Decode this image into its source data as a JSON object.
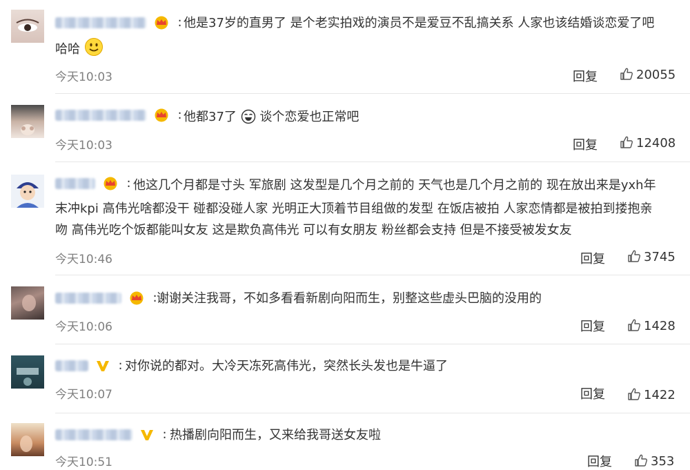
{
  "comments": [
    {
      "text_lines": [
        "他是37岁的直男了 是个老实拍戏的演员不是爱豆不乱搞关系 人家也该结婚谈恋爱了吧",
        "哈哈"
      ],
      "time": "今天10:03",
      "reply": "回复",
      "likes": "20055",
      "badge": "crown-badge-icon"
    },
    {
      "text_lines": [
        "他都37了",
        "谈个恋爱也正常吧"
      ],
      "time": "今天10:03",
      "reply": "回复",
      "likes": "12408",
      "badge": "crown-badge-icon"
    },
    {
      "text_lines": [
        "他这几个月都是寸头 军旅剧 这发型是几个月之前的 天气也是几个月之前的 现在放出来是yxh年",
        "末冲kpi 高伟光啥都没干 碰都没碰人家 光明正大顶着节目组做的发型 在饭店被拍 人家恋情都是被拍到搂抱亲",
        "吻 高伟光吃个饭都能叫女友 这是欺负高伟光 可以有女朋友 粉丝都会支持 但是不接受被发女友"
      ],
      "time": "今天10:46",
      "reply": "回复",
      "likes": "3745",
      "badge": "crown-badge-icon"
    },
    {
      "text_lines": [
        "谢谢关注我哥，不如多看看新剧向阳而生，别整这些虚头巴脑的没用的"
      ],
      "time": "今天10:06",
      "reply": "回复",
      "likes": "1428",
      "badge": "crown-badge-icon"
    },
    {
      "text_lines": [
        "对你说的都对。大冷天冻死高伟光，突然长头发也是牛逼了"
      ],
      "time": "今天10:07",
      "reply": "回复",
      "likes": "1422",
      "badge": "verified-v-icon"
    },
    {
      "text_lines": [
        "热播剧向阳而生，又来给我哥送女友啦"
      ],
      "time": "今天10:51",
      "reply": "回复",
      "likes": "353",
      "badge": "verified-v-icon"
    }
  ],
  "colors": {
    "username": "#5c7fae",
    "text": "#333333",
    "time": "#808080",
    "crown": "#f5b800",
    "crown_accent": "#e8432f",
    "verified": "#f5b800"
  }
}
